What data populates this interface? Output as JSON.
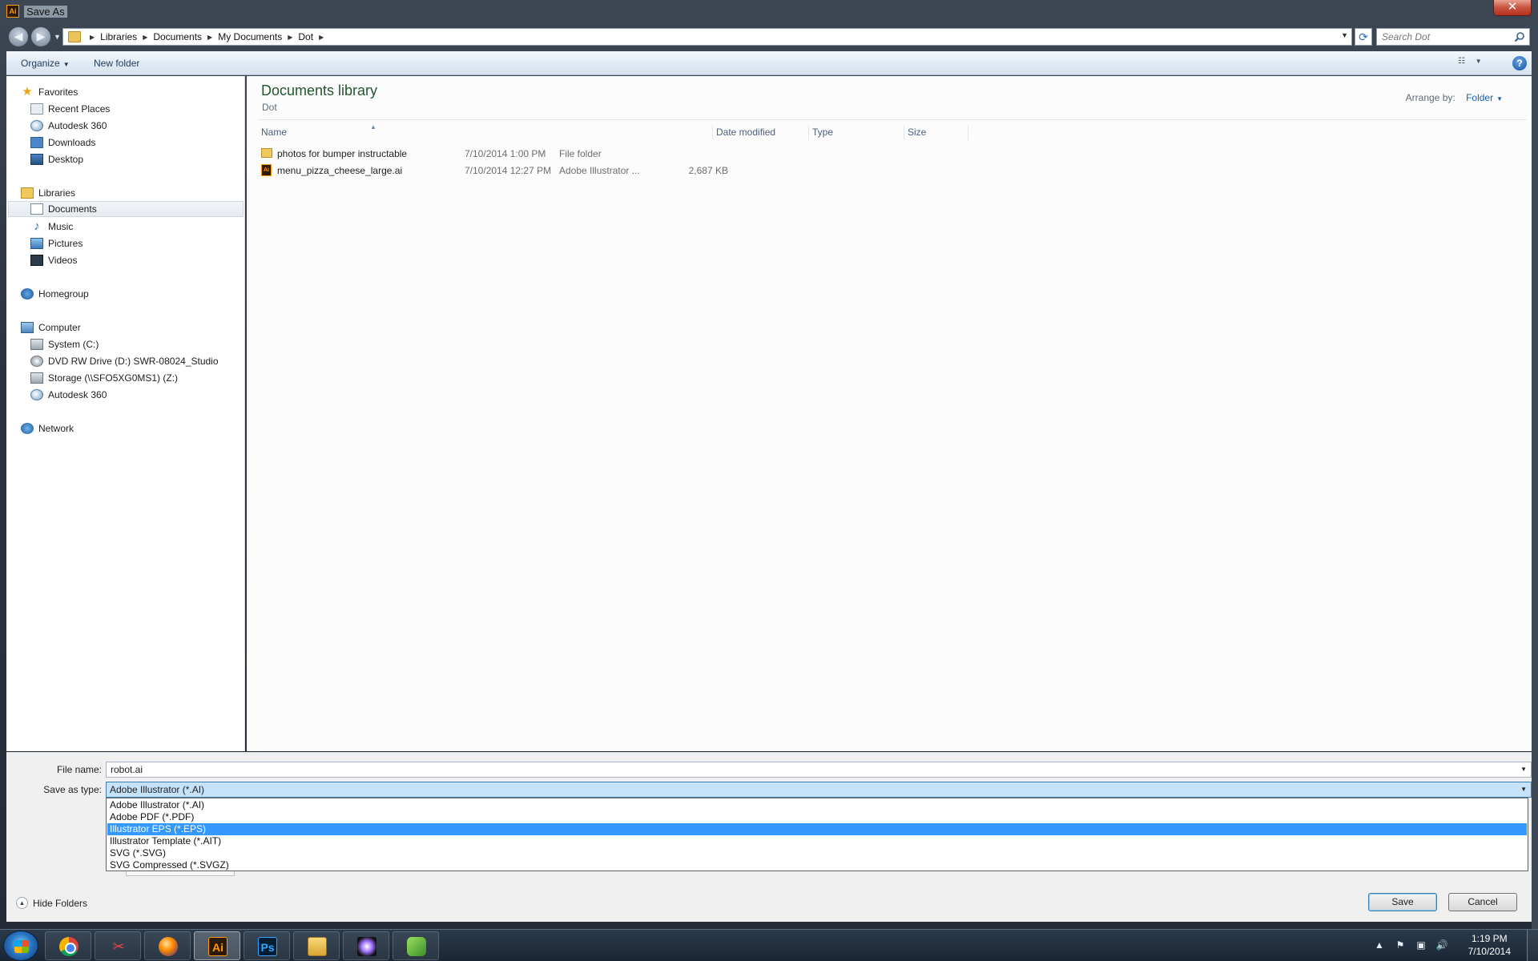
{
  "window": {
    "title": "Save As",
    "app_icon_text": "Ai",
    "close_glyph": "✕"
  },
  "nav": {
    "back_glyph": "◀",
    "forward_glyph": "▶",
    "breadcrumbs": [
      "Libraries",
      "Documents",
      "My Documents",
      "Dot"
    ],
    "search_placeholder": "Search Dot"
  },
  "toolbar": {
    "organize_label": "Organize",
    "new_folder_label": "New folder",
    "help_glyph": "?"
  },
  "sidebar": {
    "favorites_label": "Favorites",
    "favorites": [
      "Recent Places",
      "Autodesk 360",
      "Downloads",
      "Desktop"
    ],
    "libraries_label": "Libraries",
    "libraries": [
      "Documents",
      "Music",
      "Pictures",
      "Videos"
    ],
    "homegroup_label": "Homegroup",
    "computer_label": "Computer",
    "computer": [
      "System (C:)",
      "DVD RW Drive (D:) SWR-08024_Studio",
      "Storage (\\\\SFO5XG0MS1) (Z:)",
      "Autodesk 360"
    ],
    "network_label": "Network"
  },
  "library": {
    "title": "Documents library",
    "subtitle": "Dot",
    "arrange_label": "Arrange by:",
    "arrange_value": "Folder"
  },
  "columns": {
    "name": "Name",
    "date": "Date modified",
    "type": "Type",
    "size": "Size"
  },
  "files": [
    {
      "name": "photos for bumper instructable",
      "date": "7/10/2014 1:00 PM",
      "type": "File folder",
      "size": "",
      "icon": "folder-icon"
    },
    {
      "name": "menu_pizza_cheese_large.ai",
      "date": "7/10/2014 12:27 PM",
      "type": "Adobe Illustrator ...",
      "size": "2,687 KB",
      "icon": "illustrator-file-icon"
    }
  ],
  "save": {
    "file_name_label": "File name:",
    "file_name_value": "robot.ai",
    "type_label": "Save as type:",
    "type_value": "Adobe Illustrator (*.AI)",
    "type_options": [
      "Adobe Illustrator (*.AI)",
      "Adobe PDF (*.PDF)",
      "Illustrator EPS (*.EPS)",
      "Illustrator Template (*.AIT)",
      "SVG (*.SVG)",
      "SVG Compressed (*.SVGZ)"
    ],
    "highlighted_option": "Illustrator EPS (*.EPS)",
    "hide_folders_label": "Hide Folders",
    "save_button": "Save",
    "cancel_button": "Cancel"
  },
  "taskbar": {
    "ai_text": "Ai",
    "ps_text": "Ps",
    "clock_time": "1:19 PM",
    "clock_date": "7/10/2014"
  },
  "colors": {
    "highlight": "#3399ff",
    "library_title": "#20572b",
    "link_blue": "#1b5fb0"
  }
}
